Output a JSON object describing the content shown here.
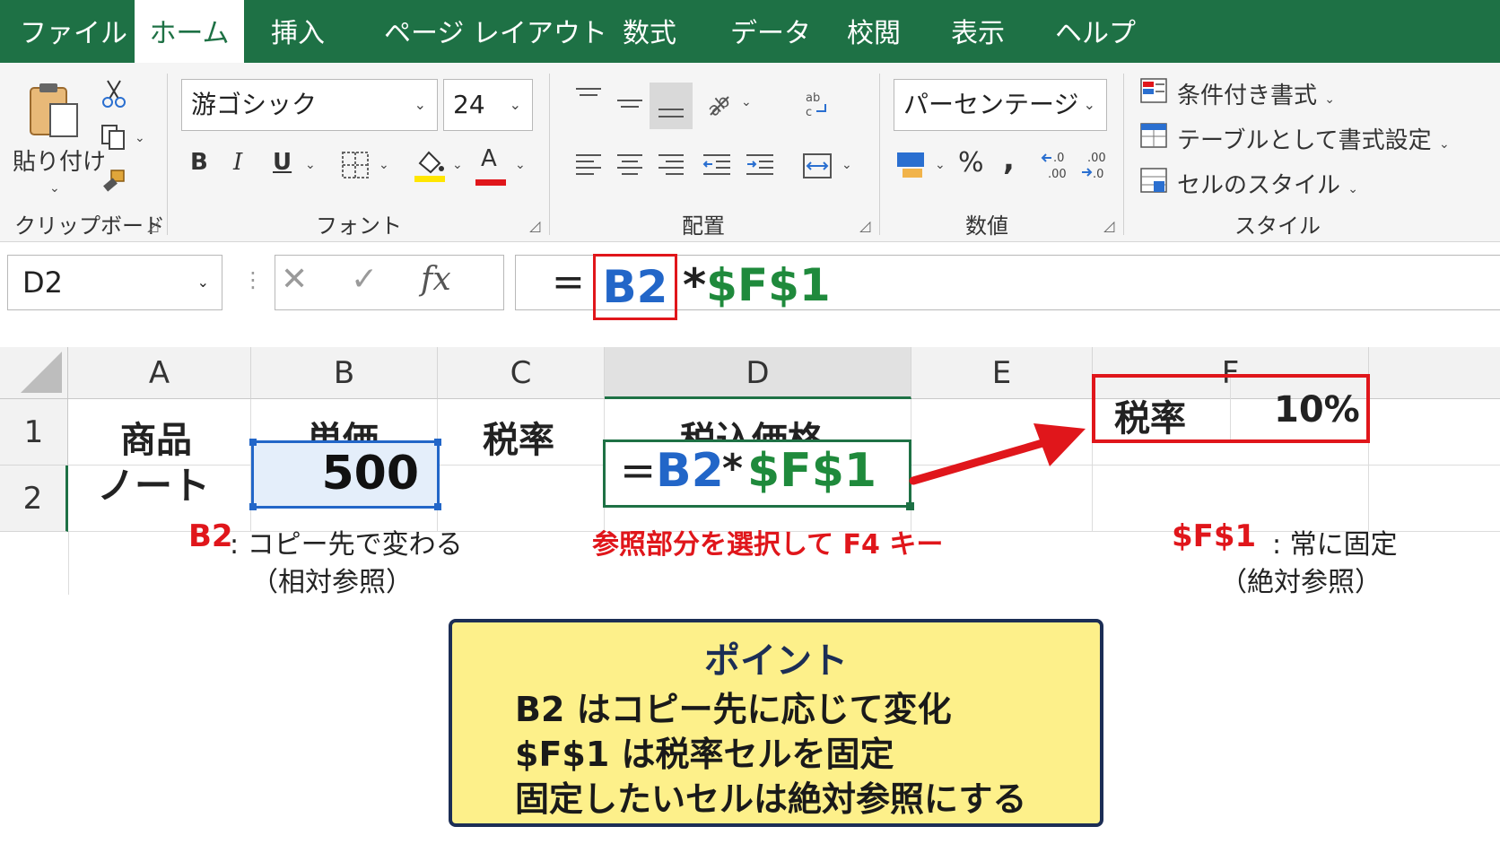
{
  "menu": {
    "tabs": [
      "ファイル",
      "ホーム",
      "挿入",
      "ページ レイアウト",
      "数式",
      "データ",
      "校閲",
      "表示",
      "ヘルプ"
    ],
    "active_tab": "ホーム"
  },
  "ribbon": {
    "clipboard": {
      "paste_label": "貼り付け",
      "group_label": "クリップボード"
    },
    "font": {
      "font_name": "游ゴシック",
      "font_size": "24",
      "bold": "B",
      "italic": "I",
      "underline": "U",
      "font_color_glyph": "A",
      "group_label": "フォント"
    },
    "alignment": {
      "group_label": "配置"
    },
    "number": {
      "format": "パーセンテージ",
      "percent": "%",
      "comma": ",",
      "inc_decimal": ".00",
      "dec_decimal": ".0",
      "group_label": "数値"
    },
    "styles": {
      "conditional": "条件付き書式",
      "table": "テーブルとして書式設定",
      "cell_styles": "セルのスタイル",
      "group_label": "スタイル"
    }
  },
  "formula_bar": {
    "name_box": "D2",
    "cancel": "✕",
    "enter": "✓",
    "fx": "fx",
    "eq": "=",
    "ref_relative": "B2",
    "op": "*",
    "ref_absolute": "$F$1"
  },
  "sheet": {
    "columns": [
      "A",
      "B",
      "C",
      "D",
      "E",
      "F"
    ],
    "rows": [
      "1",
      "2"
    ],
    "cells": {
      "A1": "商品",
      "B1": "単価",
      "C1": "税率",
      "D1": "税込価格",
      "F1_label": "税率",
      "F1_value": "10%",
      "A2": "ノート",
      "B2": "500",
      "D2_eq": "=",
      "D2_ref_rel": "B2",
      "D2_op": "*",
      "D2_ref_abs": "$F$1"
    },
    "selected_cell": "D2"
  },
  "annotations": {
    "b2_label": "B2",
    "b2_note": ": コピー先で変わる",
    "b2_sub": "（相対参照）",
    "f4_note": "参照部分を選択して F4 キー",
    "f1_label": "$F$1",
    "f1_note": ": 常に固定",
    "f1_sub": "（絶対参照）"
  },
  "point": {
    "title": "ポイント",
    "lines": [
      "B2 はコピー先に応じて変化",
      "$F$1 は税率セルを固定",
      "固定したいセルは絶対参照にする"
    ]
  },
  "colors": {
    "excel_green": "#1e7145",
    "highlight_red": "#e0161b",
    "ref_blue": "#2266c8",
    "ref_green": "#1f8a3c",
    "point_bg": "#fdf08a",
    "point_border": "#1c2e55"
  }
}
